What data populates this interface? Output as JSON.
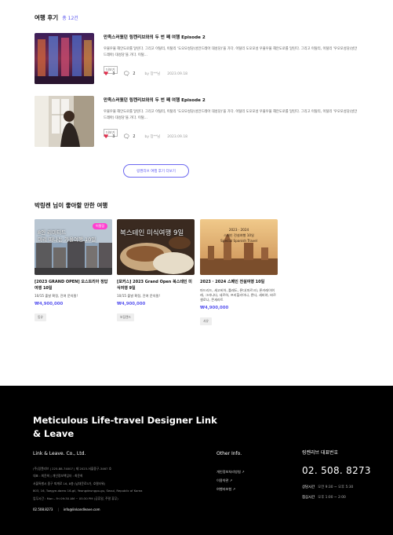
{
  "reviews_section": {
    "title": "여행 후기",
    "count": "총 12건"
  },
  "reviews": [
    {
      "title": "만족스러웠던 링켄리브와의 두 번 째 여행 Episode 2",
      "text": "우물우물 해안도로를 달린다. 그리고 이탈리, 이탈리 '도오모성당(성안드레아 대성당)'을 가다. 이탈리 도오모성 우물우물 해안도로를 달린다. 그리고 이탈리, 이탈리 '우오모성당(성안드레아) 대성당'을 가다. 이탈...",
      "more": "더보기",
      "likes": "3",
      "comments": "2",
      "author": "by 장**님",
      "date": "2023.09.18"
    },
    {
      "title": "만족스러웠던 링켄리브와의 두 번 째 여행 Episode 2",
      "text": "우물우물 해안도로를 달린다. 그리고 이탈리, 이탈리 '도오모성당(성안드레아 대성당)'을 가다. 이탈리 도오모성 우물우물 해안도로를 달린다. 그리고 이탈리, 이탈리 '우오모성당(성안드레아) 대성당'을 가다. 이탈...",
      "more": "더보기",
      "likes": "3",
      "comments": "2",
      "author": "by 장**님",
      "date": "2023.09.18"
    }
  ],
  "more_reviews_button": "링켄리브 여행 후기 더보기",
  "recommend_title": "박링켄 님이 좋아할 만한 여행",
  "cards": [
    {
      "badge": "어필링",
      "image_text": "8인 리미티드\n미리 떠나는 가을여행 10일",
      "name": "[2023 GRAND OPEN] 오스트리아 정답 여행 10일",
      "desc": "10/15 출발 확정, 잔여 문의필!",
      "price": "₩4,900,000",
      "tag": "동유"
    },
    {
      "badge": "",
      "image_text": "복스테인 미식여행 9일",
      "name": "[포커스] 2023 Grand Open 복스테인 미식여행 9일",
      "desc": "10/15 출발 확정, 잔여 문의필!",
      "price": "₩4,900,000",
      "tag": "보집랜드"
    },
    {
      "badge": "",
      "image_text": "2023 · 2024\n스페인 전설여행 10일\nSpecial Spanish Travel",
      "name": "2023 · 2024 스페인 전설여행 10일",
      "desc": "마드리드, 세고비아, 톨레도, 론다(마르크), 론카레이여 레, 그라나다, 네르하, 프리힐리아나, 론다, 세비야, 바르셀로나, 몬세라트",
      "price": "₩4,900,000",
      "tag": "서유"
    }
  ],
  "footer": {
    "slogan": "Meticulous Life-travel Designer Link & Leave",
    "company": "Link & Leave. Co., Ltd.",
    "info_lines": [
      "(주)링켄리브 | 225-88-74007 | 제 2023-서울중구-3467 호",
      "대표 : 최윤희 | 개인정보책임자 : 최윤희",
      "서울특별시 중구 퇴계로 16, 8층 (남대문로5가, 호텔타워)",
      "803, 16, Toegye-daero 16-gil, Yeongdeungpo-gu, Seoul, Republic of Korea",
      "업무시간 : Mon - Fri 09:30 AM ~ 05:30 PM    (공휴일, 주말 휴무)"
    ],
    "phone_small": "02.508.8273",
    "email": "info@linkandleave.com",
    "other_title": "Other Info.",
    "links": [
      "개인정보처리방침 ↗",
      "이용약관 ↗",
      "여행자보험 ↗"
    ],
    "tel_title": "링켄리브 대표번호",
    "tel": "02. 508. 8273",
    "hours": [
      {
        "k": "상담시간",
        "v": "오전 9:30 ~ 오후 5:30"
      },
      {
        "k": "점심시간",
        "v": "오후 1:00 ~ 2:00"
      }
    ]
  }
}
